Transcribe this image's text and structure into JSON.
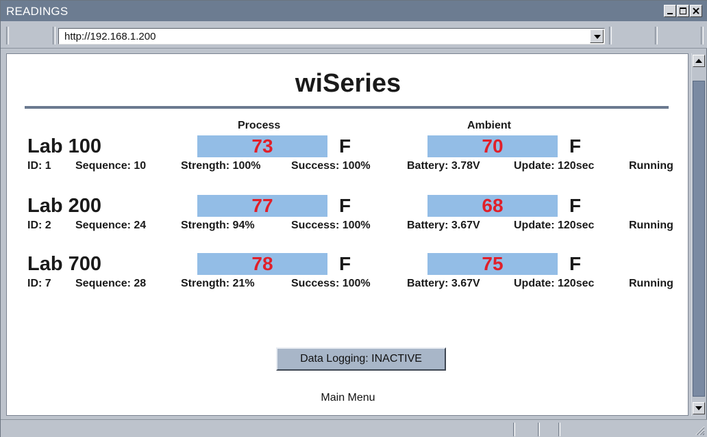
{
  "window": {
    "title": "READINGS"
  },
  "address": {
    "url": "http://192.168.1.200"
  },
  "page": {
    "title": "wiSeries",
    "columns": {
      "process": "Process",
      "ambient": "Ambient"
    },
    "labs": [
      {
        "name": "Lab 100",
        "process": "73",
        "process_unit": "F",
        "ambient": "70",
        "ambient_unit": "F",
        "id": "ID: 1",
        "sequence": "Sequence: 10",
        "strength": "Strength: 100%",
        "success": "Success: 100%",
        "battery": "Battery: 3.78V",
        "update": "Update: 120sec",
        "status": "Running"
      },
      {
        "name": "Lab 200",
        "process": "77",
        "process_unit": "F",
        "ambient": "68",
        "ambient_unit": "F",
        "id": "ID: 2",
        "sequence": "Sequence: 24",
        "strength": "Strength: 94%",
        "success": "Success: 100%",
        "battery": "Battery: 3.67V",
        "update": "Update: 120sec",
        "status": "Running"
      },
      {
        "name": "Lab 700",
        "process": "78",
        "process_unit": "F",
        "ambient": "75",
        "ambient_unit": "F",
        "id": "ID: 7",
        "sequence": "Sequence: 28",
        "strength": "Strength: 21%",
        "success": "Success: 100%",
        "battery": "Battery: 3.67V",
        "update": "Update: 120sec",
        "status": "Running"
      }
    ],
    "logging_button": "Data Logging: INACTIVE",
    "main_menu": "Main Menu"
  },
  "colors": {
    "title_bar": "#6c7c91",
    "value_box": "#93bde6",
    "value_text": "#e0202a",
    "rule": "#6b7a90"
  },
  "icons": [
    "minimize-icon",
    "maximize-icon",
    "close-icon",
    "chevron-down-icon",
    "scroll-up-icon",
    "scroll-down-icon"
  ]
}
